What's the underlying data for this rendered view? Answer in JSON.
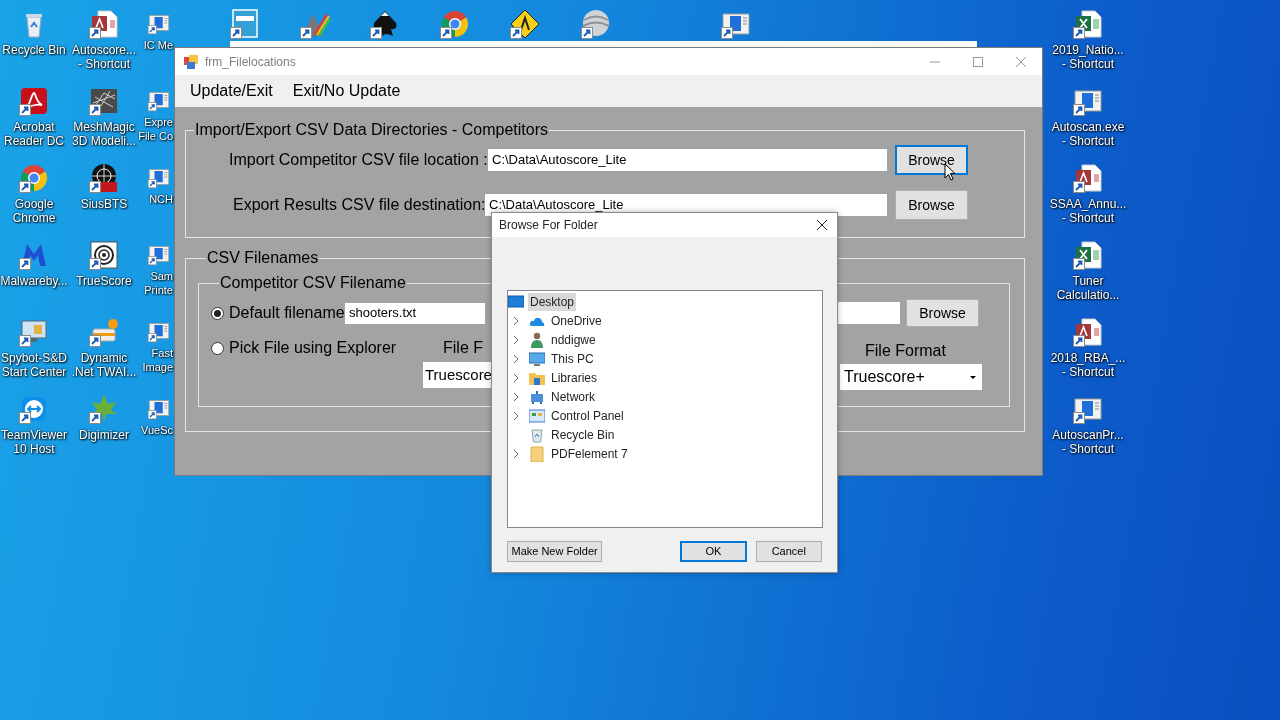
{
  "desktop": {
    "left_columns": [
      [
        {
          "label": "Recycle Bin",
          "kind": "recycle",
          "shortcut": false
        },
        {
          "label": "Acrobat\nReader DC",
          "kind": "acrobat",
          "shortcut": true
        },
        {
          "label": "Google\nChrome",
          "kind": "chrome",
          "shortcut": true
        },
        {
          "label": "Malwareby...",
          "kind": "malware",
          "shortcut": true
        },
        {
          "label": "Spybot-S&D\nStart Center",
          "kind": "spybot",
          "shortcut": true
        },
        {
          "label": "TeamViewer\n10 Host",
          "kind": "teamviewer",
          "shortcut": true
        }
      ],
      [
        {
          "label": "Autoscore...\n- Shortcut",
          "kind": "access",
          "shortcut": true
        },
        {
          "label": "MeshMagic\n3D Modeli...",
          "kind": "mesh",
          "shortcut": true
        },
        {
          "label": "SiusBTS",
          "kind": "target",
          "shortcut": true
        },
        {
          "label": "TrueScore",
          "kind": "truescore",
          "shortcut": true
        },
        {
          "label": "Dynamic\n.Net TWAI...",
          "kind": "twain",
          "shortcut": true
        },
        {
          "label": "Digimizer",
          "kind": "leaf",
          "shortcut": true
        }
      ],
      [
        {
          "label": "IC Me",
          "kind": "app",
          "shortcut": true
        },
        {
          "label": "Expre\nFile Co",
          "kind": "app",
          "shortcut": true
        },
        {
          "label": "NCH",
          "kind": "app",
          "shortcut": true
        },
        {
          "label": "Sam\nPrinte",
          "kind": "app",
          "shortcut": true
        },
        {
          "label": "Fast\nImage",
          "kind": "app",
          "shortcut": true
        },
        {
          "label": "VueSc",
          "kind": "app",
          "shortcut": true
        }
      ]
    ],
    "top_row": [
      {
        "kind": "dymo",
        "shortcut": true
      },
      {
        "kind": "prism",
        "shortcut": true
      },
      {
        "kind": "ink",
        "shortcut": true
      },
      {
        "kind": "chrome",
        "shortcut": true
      },
      {
        "kind": "sign",
        "shortcut": true
      },
      {
        "kind": "globe",
        "shortcut": true
      },
      {
        "kind": "app",
        "shortcut": true
      }
    ],
    "right_column": [
      {
        "label": "2019_Natio...\n- Shortcut",
        "kind": "excel",
        "shortcut": true
      },
      {
        "label": "Autoscan.exe\n- Shortcut",
        "kind": "app",
        "shortcut": true
      },
      {
        "label": "SSAA_Annu...\n- Shortcut",
        "kind": "access",
        "shortcut": true
      },
      {
        "label": "Tuner\nCalculatio...",
        "kind": "excel",
        "shortcut": true
      },
      {
        "label": "2018_RBA_...\n- Shortcut",
        "kind": "access",
        "shortcut": true
      },
      {
        "label": "AutoscanPr...\n- Shortcut",
        "kind": "app",
        "shortcut": true
      }
    ]
  },
  "form": {
    "title": "frm_Filelocations",
    "menu": [
      "Update/Exit",
      "Exit/No Update"
    ],
    "directories": {
      "caption": "Import/Export CSV Data Directories - Competitors",
      "rows": [
        {
          "label": "Import Competitor CSV file location :",
          "value": "C:\\Data\\Autoscore_Lite",
          "button": "Browse",
          "focused": true
        },
        {
          "label": "Export Results CSV file destination:",
          "value": "C:\\Data\\Autoscore_Lite",
          "button": "Browse",
          "focused": false
        }
      ]
    },
    "filenames": {
      "caption": "CSV Filenames",
      "competitor": {
        "caption": "Competitor CSV Filename",
        "options": [
          {
            "label": "Default filename",
            "selected": true
          },
          {
            "label": "Pick File using Explorer",
            "selected": false
          }
        ],
        "filename": "shooters.txt",
        "browse": "Browse",
        "format_label_1": "File F",
        "format_1": "Truescore",
        "format_label_2": "File Format",
        "format_2": "Truescore+"
      }
    }
  },
  "dialog": {
    "title": "Browse For Folder",
    "tree": [
      {
        "label": "Desktop",
        "kind": "desktop",
        "selected": true,
        "children": [
          {
            "label": "OneDrive",
            "kind": "cloud",
            "expandable": true,
            "selected": false
          },
          {
            "label": "nddigwe",
            "kind": "user",
            "expandable": true,
            "selected": false
          },
          {
            "label": "This PC",
            "kind": "pc",
            "expandable": true,
            "selected": false
          },
          {
            "label": "Libraries",
            "kind": "library",
            "expandable": true,
            "selected": false
          },
          {
            "label": "Network",
            "kind": "network",
            "expandable": true,
            "selected": false
          },
          {
            "label": "Control Panel",
            "kind": "control",
            "expandable": true,
            "selected": false
          },
          {
            "label": "Recycle Bin",
            "kind": "recycle",
            "expandable": false,
            "selected": false
          },
          {
            "label": "PDFelement 7",
            "kind": "folder",
            "expandable": true,
            "selected": false
          }
        ]
      }
    ],
    "buttons": [
      {
        "label": "Make New Folder",
        "default": false
      },
      {
        "label": "OK",
        "default": true
      },
      {
        "label": "Cancel",
        "default": false
      }
    ]
  }
}
